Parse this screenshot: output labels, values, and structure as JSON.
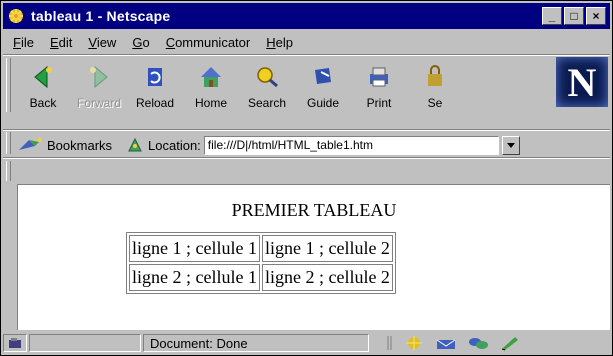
{
  "window": {
    "title": "tableau 1 - Netscape"
  },
  "window_controls": [
    "_",
    "□",
    "×"
  ],
  "menu": [
    "File",
    "Edit",
    "View",
    "Go",
    "Communicator",
    "Help"
  ],
  "menu_mnemonics": [
    "F",
    "E",
    "V",
    "G",
    "C",
    "H"
  ],
  "toolbar": {
    "buttons": [
      {
        "label": "Back",
        "icon": "back-arrow-icon",
        "enabled": true
      },
      {
        "label": "Forward",
        "icon": "forward-arrow-icon",
        "enabled": false
      },
      {
        "label": "Reload",
        "icon": "reload-icon",
        "enabled": true
      },
      {
        "label": "Home",
        "icon": "home-icon",
        "enabled": true
      },
      {
        "label": "Search",
        "icon": "search-icon",
        "enabled": true
      },
      {
        "label": "Guide",
        "icon": "guide-icon",
        "enabled": true
      },
      {
        "label": "Print",
        "icon": "print-icon",
        "enabled": true
      },
      {
        "label": "Se",
        "icon": "security-icon",
        "enabled": true
      }
    ],
    "logo": "N"
  },
  "location_bar": {
    "bookmarks_label": "Bookmarks",
    "location_label": "Location:",
    "url": "file:///D|/html/HTML_table1.htm"
  },
  "page": {
    "heading": "PREMIER TABLEAU",
    "table": [
      [
        "ligne 1 ; cellule 1",
        "ligne 1 ; cellule 2"
      ],
      [
        "ligne 2 ; cellule 1",
        "ligne 2 ; cellule 2"
      ]
    ]
  },
  "status": {
    "text": "Document: Done"
  },
  "colors": {
    "titlebar": "#000080",
    "chrome": "#c0c0c0"
  }
}
